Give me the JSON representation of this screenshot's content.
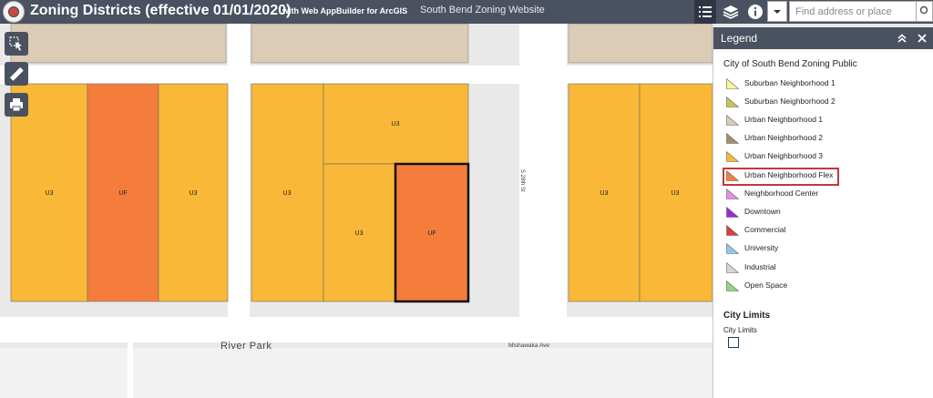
{
  "header": {
    "title": "Zoning Districts (effective 01/01/2020)",
    "subtitle": "with Web AppBuilder for ArcGIS",
    "website_link": "South Bend Zoning Website"
  },
  "search": {
    "placeholder": "Find address or place"
  },
  "legend": {
    "panel_title": "Legend",
    "layer_title": "City of South Bend Zoning Public",
    "items": [
      {
        "label": "Suburban Neighborhood 1",
        "color": "#fff59a"
      },
      {
        "label": "Suburban Neighborhood 2",
        "color": "#c7c453"
      },
      {
        "label": "Urban Neighborhood 1",
        "color": "#dccbb5"
      },
      {
        "label": "Urban Neighborhood 2",
        "color": "#a38d6a"
      },
      {
        "label": "Urban Neighborhood 3",
        "color": "#f9b838"
      },
      {
        "label": "Urban Neighborhood Flex",
        "color": "#f57d3c"
      },
      {
        "label": "Neighborhood Center",
        "color": "#e98ce6"
      },
      {
        "label": "Downtown",
        "color": "#9c2ad8"
      },
      {
        "label": "Commercial",
        "color": "#e23b3b"
      },
      {
        "label": "University",
        "color": "#92c6ee"
      },
      {
        "label": "Industrial",
        "color": "#d6d6d6"
      },
      {
        "label": "Open Space",
        "color": "#92d67e"
      }
    ],
    "city_limits_heading": "City Limits",
    "city_limits_label": "City Limits"
  },
  "map": {
    "parcel_labels": [
      "U3",
      "UF",
      "U3",
      "U3",
      "U3",
      "U3",
      "UF",
      "U3",
      "U3"
    ],
    "streets": {
      "river_park": "River Park",
      "mishawaka": "Mishawaka Ave",
      "s28th": "S 28th St"
    },
    "colors": {
      "u3": "#f9b838",
      "uf": "#f57d3c",
      "un1": "#dccbb5",
      "road": "#ffffff",
      "background": "#e9e9e9",
      "selection": "#111111"
    }
  },
  "icons": {
    "header": [
      "legend-list-icon",
      "layers-icon",
      "info-icon",
      "chevron-down-icon",
      "search-icon"
    ],
    "tools": [
      "select-icon",
      "measure-icon",
      "print-icon"
    ],
    "nav": [
      "zoom-in-icon",
      "zoom-out-icon",
      "home-icon",
      "locate-icon"
    ],
    "legend_header": [
      "collapse-up-icon",
      "close-icon"
    ]
  }
}
